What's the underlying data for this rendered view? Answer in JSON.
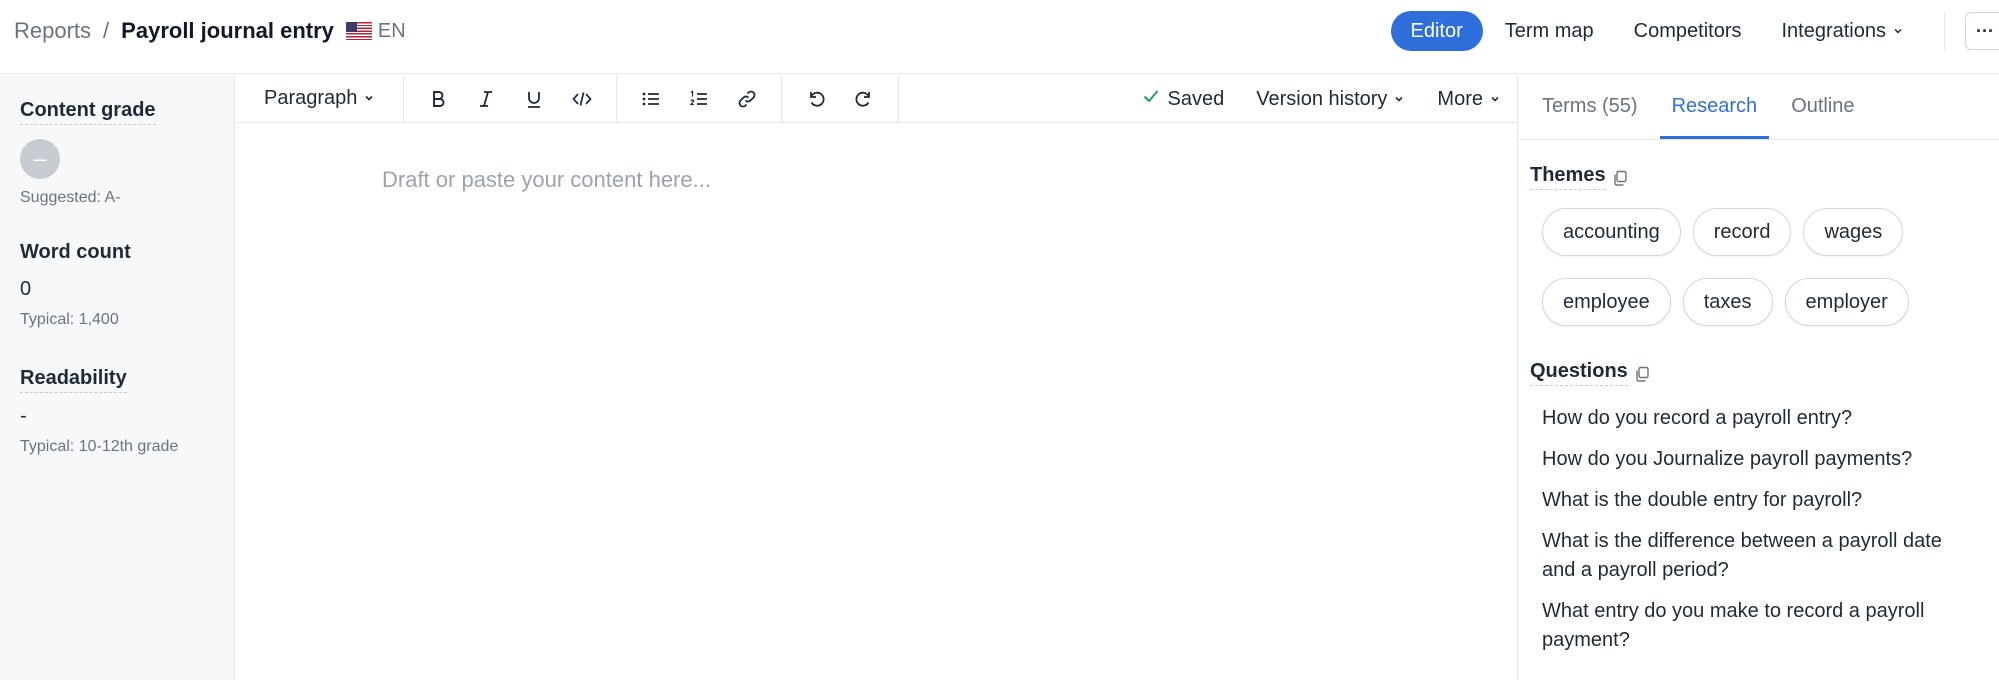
{
  "header": {
    "breadcrumb_parent": "Reports",
    "breadcrumb_sep": "/",
    "title": "Payroll journal entry",
    "language": "EN",
    "nav": [
      {
        "label": "Editor"
      },
      {
        "label": "Term map"
      },
      {
        "label": "Competitors"
      },
      {
        "label": "Integrations"
      }
    ],
    "more_label": "···",
    "chevron": "⌄"
  },
  "sidebar": {
    "content_grade": {
      "label": "Content grade",
      "value": "–",
      "sub": "Suggested: A-"
    },
    "word_count": {
      "label": "Word count",
      "value": "0",
      "sub": "Typical: 1,400"
    },
    "readability": {
      "label": "Readability",
      "value": "-",
      "sub": "Typical: 10-12th grade"
    }
  },
  "toolbar": {
    "paragraph_label": "Paragraph",
    "saved_label": "Saved",
    "version_history_label": "Version history",
    "more_label": "More",
    "tools": [
      "bold-icon",
      "italic-icon",
      "underline-icon",
      "code-icon",
      "bullet-list-icon",
      "numbered-list-icon",
      "link-icon",
      "undo-icon",
      "redo-icon"
    ]
  },
  "editor": {
    "placeholder": "Draft or paste your content here..."
  },
  "panel": {
    "tabs": [
      {
        "label": "Terms (55)"
      },
      {
        "label": "Research"
      },
      {
        "label": "Outline"
      }
    ],
    "active_tab": "Research",
    "themes_label": "Themes",
    "themes": [
      "accounting",
      "record",
      "wages",
      "employee",
      "taxes",
      "employer"
    ],
    "questions_label": "Questions",
    "questions": [
      "How do you record a payroll entry?",
      "How do you Journalize payroll payments?",
      "What is the double entry for payroll?",
      "What is the difference between a payroll date and a payroll period?",
      "What entry do you make to record a payroll payment?"
    ]
  },
  "colors": {
    "accent": "#2f6fdc",
    "saved_check": "#22a06b"
  }
}
